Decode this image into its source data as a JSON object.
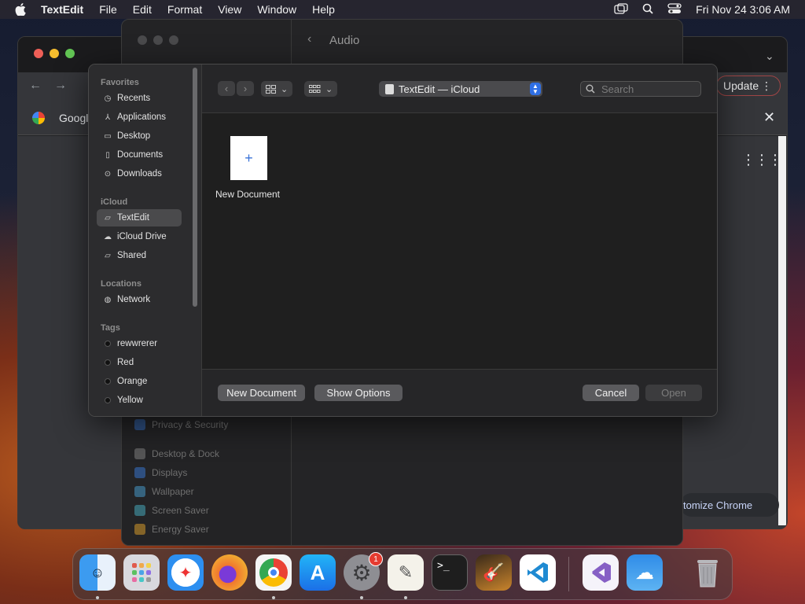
{
  "menubar": {
    "app_name": "TextEdit",
    "items": [
      "File",
      "Edit",
      "Format",
      "View",
      "Window",
      "Help"
    ],
    "clock": "Fri Nov 24  3:06 AM",
    "icons": [
      "window-icon",
      "search-icon",
      "control-center-icon"
    ]
  },
  "chrome": {
    "bookmark_tab": "Googl",
    "update_label": "Update",
    "customize_label": "tomize Chrome"
  },
  "settings": {
    "title": "Audio",
    "side_items": [
      "Privacy & Security",
      "Desktop & Dock",
      "Displays",
      "Wallpaper",
      "Screen Saver",
      "Energy Saver"
    ]
  },
  "dialog": {
    "sections": {
      "favorites": "Favorites",
      "icloud": "iCloud",
      "locations": "Locations",
      "tags": "Tags"
    },
    "favorites": [
      "Recents",
      "Applications",
      "Desktop",
      "Documents",
      "Downloads"
    ],
    "icloud": [
      "TextEdit",
      "iCloud Drive",
      "Shared"
    ],
    "locations": [
      "Network"
    ],
    "tags": [
      "rewwrerer",
      "Red",
      "Orange",
      "Yellow"
    ],
    "selected": "TextEdit",
    "location_label": "TextEdit — iCloud",
    "search_placeholder": "Search",
    "file_label": "New Document",
    "buttons": {
      "new_document": "New Document",
      "show_options": "Show Options",
      "cancel": "Cancel",
      "open": "Open"
    }
  },
  "dock": {
    "apps": [
      "Finder",
      "Launchpad",
      "Safari",
      "Firefox",
      "Chrome",
      "App Store",
      "System Settings",
      "TextEdit",
      "Terminal",
      "GarageBand",
      "VS Code",
      "Visual Studio",
      "Weather",
      "Trash"
    ],
    "settings_badge": "1"
  }
}
